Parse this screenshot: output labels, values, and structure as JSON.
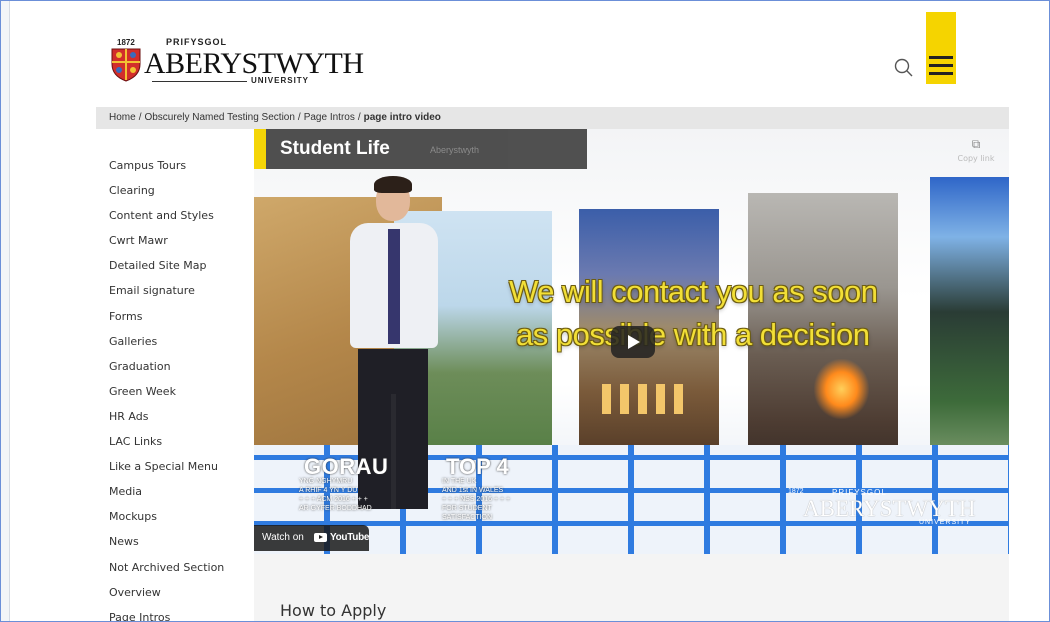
{
  "header": {
    "logo": {
      "year": "1872",
      "prifysgol": "PRIFYSGOL",
      "name": "ABERYSTWYTH",
      "university": "UNIVERSITY"
    },
    "search_icon": "search-icon",
    "menu_icon": "hamburger-menu-icon",
    "accent_color": "#f5d400"
  },
  "breadcrumb": {
    "items": [
      "Home",
      "Obscurely Named Testing Section",
      "Page Intros"
    ],
    "separator": "/",
    "current": "page intro video"
  },
  "sidebar": {
    "items": [
      {
        "label": "Campus Tours"
      },
      {
        "label": "Clearing"
      },
      {
        "label": "Content and Styles"
      },
      {
        "label": "Cwrt Mawr"
      },
      {
        "label": "Detailed Site Map"
      },
      {
        "label": "Email signature"
      },
      {
        "label": "Forms"
      },
      {
        "label": "Galleries"
      },
      {
        "label": "Graduation"
      },
      {
        "label": "Green Week"
      },
      {
        "label": "HR Ads"
      },
      {
        "label": "LAC Links"
      },
      {
        "label": "Like a Special Menu"
      },
      {
        "label": "Media"
      },
      {
        "label": "Mockups"
      },
      {
        "label": "News"
      },
      {
        "label": "Not Archived Section"
      },
      {
        "label": "Overview"
      },
      {
        "label": "Page Intros"
      }
    ]
  },
  "video": {
    "title": "Student Life",
    "subtitle": "Aberystwyth",
    "copy_link_label": "Copy link",
    "copy_icon": "copy-icon",
    "caption_line1": "We will contact you as soon",
    "caption_line2": "as possible with a decision",
    "badge_left": {
      "headline": "GORAU",
      "line1": "YNG NGHYMRU",
      "line2": "A RHIF 4 YN Y DU",
      "line3": "+ + + ACM 2016 + + +",
      "line4": "AR GYFER BODDHAD"
    },
    "badge_right": {
      "headline": "TOP 4",
      "line1": "IN THE UK",
      "line2": "AND 1st IN WALES",
      "line3": "+ + + NSS 2016 + + +",
      "line4": "FOR STUDENT",
      "line5": "SATISFACTION"
    },
    "watermark": {
      "year": "1872",
      "prifysgol": "PRIFYSGOL",
      "name": "ABERYSTWYTH",
      "university": "UNIVERSITY"
    },
    "watch_on": "Watch on",
    "youtube": "YouTube",
    "play_icon": "play-icon",
    "floor_grid_color": "#2f7be0",
    "caption_color": "#f2df36"
  },
  "main": {
    "section_heading": "How to Apply"
  }
}
